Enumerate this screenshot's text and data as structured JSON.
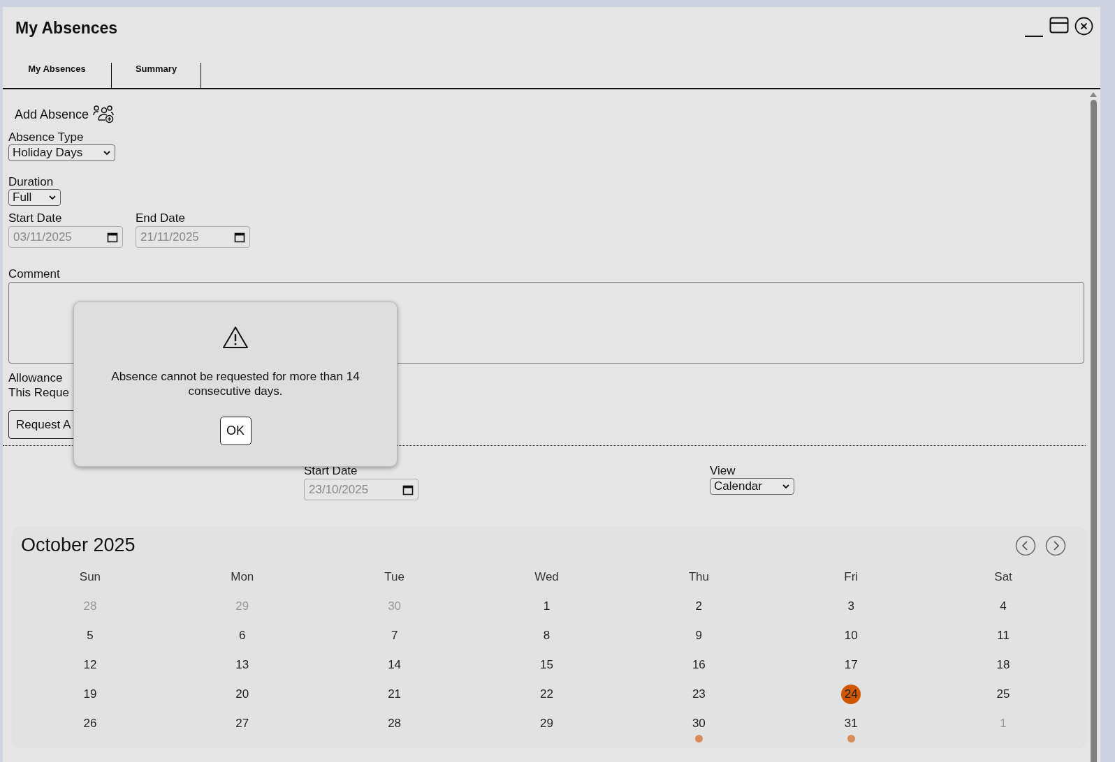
{
  "window": {
    "title": "My Absences"
  },
  "tabs": [
    {
      "label": "My Absences"
    },
    {
      "label": "Summary"
    }
  ],
  "form": {
    "heading": "Add Absence",
    "absence_type": {
      "label": "Absence Type",
      "value": "Holiday Days"
    },
    "duration": {
      "label": "Duration",
      "value": "Full"
    },
    "start_date": {
      "label": "Start Date",
      "value": "03/11/2025",
      "disabled": true
    },
    "end_date": {
      "label": "End Date",
      "value": "21/11/2025",
      "disabled": true
    },
    "comment": {
      "label": "Comment"
    },
    "allowance_lines": [
      "Allowance",
      "This Reque"
    ],
    "request_button": "Request A"
  },
  "filters": {
    "start_date": {
      "label": "Start Date",
      "value": "23/10/2025",
      "disabled": true
    },
    "view": {
      "label": "View",
      "value": "Calendar"
    }
  },
  "calendar": {
    "title": "October 2025",
    "weekdays": [
      "Sun",
      "Mon",
      "Tue",
      "Wed",
      "Thu",
      "Fri",
      "Sat"
    ],
    "weeks": [
      [
        {
          "day": "28",
          "muted": true
        },
        {
          "day": "29",
          "muted": true
        },
        {
          "day": "30",
          "muted": true
        },
        {
          "day": "1",
          "muted": false
        },
        {
          "day": "2",
          "muted": false
        },
        {
          "day": "3",
          "muted": false
        },
        {
          "day": "4",
          "muted": false
        }
      ],
      [
        {
          "day": "5",
          "muted": false
        },
        {
          "day": "6",
          "muted": false
        },
        {
          "day": "7",
          "muted": false
        },
        {
          "day": "8",
          "muted": false
        },
        {
          "day": "9",
          "muted": false
        },
        {
          "day": "10",
          "muted": false
        },
        {
          "day": "11",
          "muted": false
        }
      ],
      [
        {
          "day": "12",
          "muted": false
        },
        {
          "day": "13",
          "muted": false
        },
        {
          "day": "14",
          "muted": false
        },
        {
          "day": "15",
          "muted": false
        },
        {
          "day": "16",
          "muted": false
        },
        {
          "day": "17",
          "muted": false
        },
        {
          "day": "18",
          "muted": false
        }
      ],
      [
        {
          "day": "19",
          "muted": false
        },
        {
          "day": "20",
          "muted": false
        },
        {
          "day": "21",
          "muted": false
        },
        {
          "day": "22",
          "muted": false
        },
        {
          "day": "23",
          "muted": false
        },
        {
          "day": "24",
          "muted": false,
          "today": true
        },
        {
          "day": "25",
          "muted": false
        }
      ],
      [
        {
          "day": "26",
          "muted": false
        },
        {
          "day": "27",
          "muted": false
        },
        {
          "day": "28",
          "muted": false
        },
        {
          "day": "29",
          "muted": false
        },
        {
          "day": "30",
          "muted": false,
          "color": "#d98b5a"
        },
        {
          "day": "31",
          "muted": false,
          "color": "#d98b5a"
        },
        {
          "day": "1",
          "muted": true
        }
      ]
    ]
  },
  "dialog": {
    "message": "Absence cannot be requested for more than 14 consecutive days.",
    "button": "OK"
  }
}
